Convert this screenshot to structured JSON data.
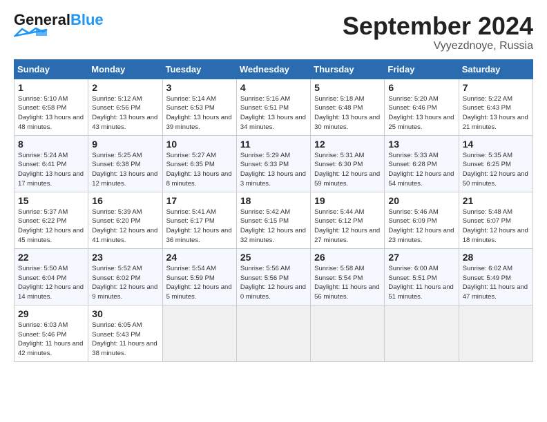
{
  "header": {
    "logo_general": "General",
    "logo_blue": "Blue",
    "month_title": "September 2024",
    "location": "Vyyezdnoye, Russia"
  },
  "calendar": {
    "days_of_week": [
      "Sunday",
      "Monday",
      "Tuesday",
      "Wednesday",
      "Thursday",
      "Friday",
      "Saturday"
    ],
    "weeks": [
      [
        {
          "day": "",
          "empty": true
        },
        {
          "day": "",
          "empty": true
        },
        {
          "day": "",
          "empty": true
        },
        {
          "day": "",
          "empty": true
        },
        {
          "day": "",
          "empty": true
        },
        {
          "day": "",
          "empty": true
        },
        {
          "day": "7",
          "sunrise": "Sunrise: 5:22 AM",
          "sunset": "Sunset: 6:43 PM",
          "daylight": "Daylight: 13 hours and 21 minutes."
        }
      ],
      [
        {
          "day": "1",
          "sunrise": "Sunrise: 5:10 AM",
          "sunset": "Sunset: 6:58 PM",
          "daylight": "Daylight: 13 hours and 48 minutes."
        },
        {
          "day": "2",
          "sunrise": "Sunrise: 5:12 AM",
          "sunset": "Sunset: 6:56 PM",
          "daylight": "Daylight: 13 hours and 43 minutes."
        },
        {
          "day": "3",
          "sunrise": "Sunrise: 5:14 AM",
          "sunset": "Sunset: 6:53 PM",
          "daylight": "Daylight: 13 hours and 39 minutes."
        },
        {
          "day": "4",
          "sunrise": "Sunrise: 5:16 AM",
          "sunset": "Sunset: 6:51 PM",
          "daylight": "Daylight: 13 hours and 34 minutes."
        },
        {
          "day": "5",
          "sunrise": "Sunrise: 5:18 AM",
          "sunset": "Sunset: 6:48 PM",
          "daylight": "Daylight: 13 hours and 30 minutes."
        },
        {
          "day": "6",
          "sunrise": "Sunrise: 5:20 AM",
          "sunset": "Sunset: 6:46 PM",
          "daylight": "Daylight: 13 hours and 25 minutes."
        },
        {
          "day": "7",
          "sunrise": "Sunrise: 5:22 AM",
          "sunset": "Sunset: 6:43 PM",
          "daylight": "Daylight: 13 hours and 21 minutes."
        }
      ],
      [
        {
          "day": "8",
          "sunrise": "Sunrise: 5:24 AM",
          "sunset": "Sunset: 6:41 PM",
          "daylight": "Daylight: 13 hours and 17 minutes."
        },
        {
          "day": "9",
          "sunrise": "Sunrise: 5:25 AM",
          "sunset": "Sunset: 6:38 PM",
          "daylight": "Daylight: 13 hours and 12 minutes."
        },
        {
          "day": "10",
          "sunrise": "Sunrise: 5:27 AM",
          "sunset": "Sunset: 6:35 PM",
          "daylight": "Daylight: 13 hours and 8 minutes."
        },
        {
          "day": "11",
          "sunrise": "Sunrise: 5:29 AM",
          "sunset": "Sunset: 6:33 PM",
          "daylight": "Daylight: 13 hours and 3 minutes."
        },
        {
          "day": "12",
          "sunrise": "Sunrise: 5:31 AM",
          "sunset": "Sunset: 6:30 PM",
          "daylight": "Daylight: 12 hours and 59 minutes."
        },
        {
          "day": "13",
          "sunrise": "Sunrise: 5:33 AM",
          "sunset": "Sunset: 6:28 PM",
          "daylight": "Daylight: 12 hours and 54 minutes."
        },
        {
          "day": "14",
          "sunrise": "Sunrise: 5:35 AM",
          "sunset": "Sunset: 6:25 PM",
          "daylight": "Daylight: 12 hours and 50 minutes."
        }
      ],
      [
        {
          "day": "15",
          "sunrise": "Sunrise: 5:37 AM",
          "sunset": "Sunset: 6:22 PM",
          "daylight": "Daylight: 12 hours and 45 minutes."
        },
        {
          "day": "16",
          "sunrise": "Sunrise: 5:39 AM",
          "sunset": "Sunset: 6:20 PM",
          "daylight": "Daylight: 12 hours and 41 minutes."
        },
        {
          "day": "17",
          "sunrise": "Sunrise: 5:41 AM",
          "sunset": "Sunset: 6:17 PM",
          "daylight": "Daylight: 12 hours and 36 minutes."
        },
        {
          "day": "18",
          "sunrise": "Sunrise: 5:42 AM",
          "sunset": "Sunset: 6:15 PM",
          "daylight": "Daylight: 12 hours and 32 minutes."
        },
        {
          "day": "19",
          "sunrise": "Sunrise: 5:44 AM",
          "sunset": "Sunset: 6:12 PM",
          "daylight": "Daylight: 12 hours and 27 minutes."
        },
        {
          "day": "20",
          "sunrise": "Sunrise: 5:46 AM",
          "sunset": "Sunset: 6:09 PM",
          "daylight": "Daylight: 12 hours and 23 minutes."
        },
        {
          "day": "21",
          "sunrise": "Sunrise: 5:48 AM",
          "sunset": "Sunset: 6:07 PM",
          "daylight": "Daylight: 12 hours and 18 minutes."
        }
      ],
      [
        {
          "day": "22",
          "sunrise": "Sunrise: 5:50 AM",
          "sunset": "Sunset: 6:04 PM",
          "daylight": "Daylight: 12 hours and 14 minutes."
        },
        {
          "day": "23",
          "sunrise": "Sunrise: 5:52 AM",
          "sunset": "Sunset: 6:02 PM",
          "daylight": "Daylight: 12 hours and 9 minutes."
        },
        {
          "day": "24",
          "sunrise": "Sunrise: 5:54 AM",
          "sunset": "Sunset: 5:59 PM",
          "daylight": "Daylight: 12 hours and 5 minutes."
        },
        {
          "day": "25",
          "sunrise": "Sunrise: 5:56 AM",
          "sunset": "Sunset: 5:56 PM",
          "daylight": "Daylight: 12 hours and 0 minutes."
        },
        {
          "day": "26",
          "sunrise": "Sunrise: 5:58 AM",
          "sunset": "Sunset: 5:54 PM",
          "daylight": "Daylight: 11 hours and 56 minutes."
        },
        {
          "day": "27",
          "sunrise": "Sunrise: 6:00 AM",
          "sunset": "Sunset: 5:51 PM",
          "daylight": "Daylight: 11 hours and 51 minutes."
        },
        {
          "day": "28",
          "sunrise": "Sunrise: 6:02 AM",
          "sunset": "Sunset: 5:49 PM",
          "daylight": "Daylight: 11 hours and 47 minutes."
        }
      ],
      [
        {
          "day": "29",
          "sunrise": "Sunrise: 6:03 AM",
          "sunset": "Sunset: 5:46 PM",
          "daylight": "Daylight: 11 hours and 42 minutes."
        },
        {
          "day": "30",
          "sunrise": "Sunrise: 6:05 AM",
          "sunset": "Sunset: 5:43 PM",
          "daylight": "Daylight: 11 hours and 38 minutes."
        },
        {
          "day": "",
          "empty": true
        },
        {
          "day": "",
          "empty": true
        },
        {
          "day": "",
          "empty": true
        },
        {
          "day": "",
          "empty": true
        },
        {
          "day": "",
          "empty": true
        }
      ]
    ]
  }
}
